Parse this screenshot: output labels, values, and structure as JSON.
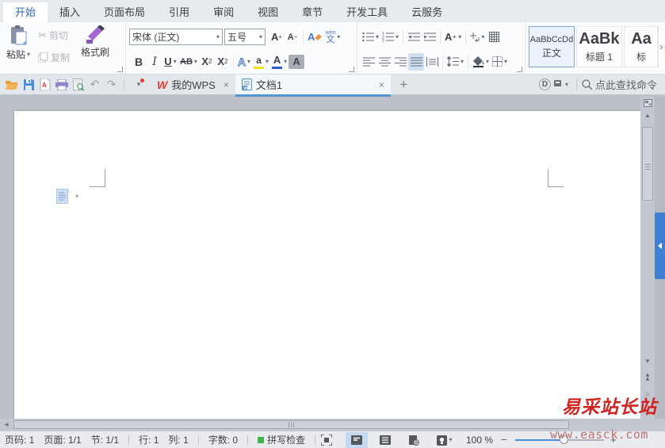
{
  "menu": {
    "tabs": [
      {
        "label": "开始",
        "active": true
      },
      {
        "label": "插入"
      },
      {
        "label": "页面布局"
      },
      {
        "label": "引用"
      },
      {
        "label": "审阅"
      },
      {
        "label": "视图"
      },
      {
        "label": "章节"
      },
      {
        "label": "开发工具"
      },
      {
        "label": "云服务"
      }
    ]
  },
  "ribbon": {
    "clipboard": {
      "paste": "粘贴",
      "cut": "剪切",
      "copy": "复制",
      "painter": "格式刷"
    },
    "font": {
      "family": "宋体 (正文)",
      "size": "五号",
      "bold": "B",
      "italic": "I",
      "underline": "U",
      "strike": "AB",
      "sup_base": "X",
      "sup_exp": "2",
      "sub_base": "X",
      "sub_idx": "2",
      "inc_letter": "A",
      "inc_sign": "+",
      "dec_letter": "A",
      "dec_sign": "−",
      "clear_letter": "A",
      "pinyin_top": "wén",
      "pinyin_char": "文",
      "effect_letter": "A",
      "highlight_letter": "a",
      "color_letter": "A",
      "shade_letter": "A"
    },
    "styles": [
      {
        "sample": "AaBbCcDd",
        "label": "正文",
        "selected": true
      },
      {
        "sample": "AaBk",
        "label": "标题 1"
      },
      {
        "sample": "Aa",
        "label": "标"
      }
    ]
  },
  "tabbar": {
    "doc_tabs": [
      {
        "label": "我的WPS"
      },
      {
        "label": "文档1",
        "active": true
      }
    ],
    "search_hint": "点此查找命令",
    "docer_letter": "D",
    "wps_logo": "W"
  },
  "statusbar": {
    "page_no": "页码: 1",
    "pages": "页面: 1/1",
    "section": "节: 1/1",
    "line": "行: 1",
    "column": "列: 1",
    "words": "字数: 0",
    "spellcheck": "拼写检查",
    "zoom": "100 %"
  },
  "icons": {
    "dropdown": "▾",
    "close": "×",
    "plus": "+",
    "minus": "−",
    "chevron_right": "›",
    "undo": "↶",
    "redo": "↷",
    "up": "▲",
    "down": "▼",
    "circle": "○",
    "scissors": "✂"
  },
  "watermark": {
    "title": "易采站长站",
    "url": "www.easck.com"
  },
  "colors": {
    "accent": "#4a90d9",
    "tab_underline": "#5795d2",
    "watermark_red": "#d02420",
    "highlight_yellow": "#f3e11b",
    "font_color_blue": "#2e5bd7"
  }
}
